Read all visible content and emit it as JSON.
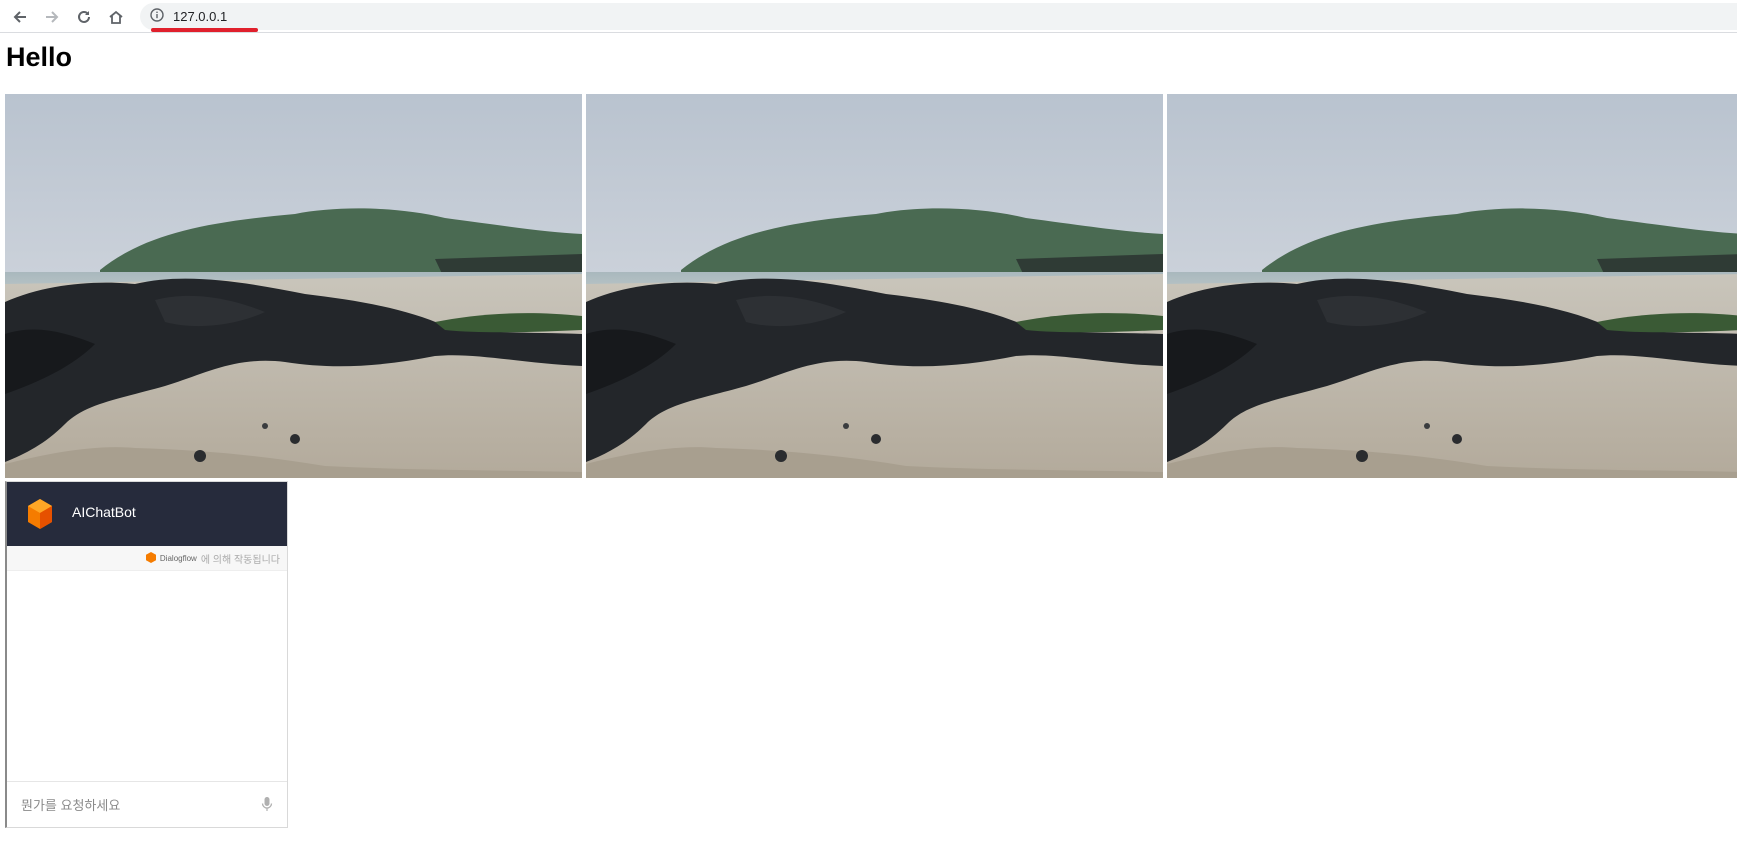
{
  "browser": {
    "url": "127.0.0.1",
    "icons": [
      "back-icon",
      "forward-icon",
      "reload-icon",
      "home-icon",
      "info-icon"
    ]
  },
  "page": {
    "heading": "Hello"
  },
  "photos": [
    {
      "name": "beach-photo-1"
    },
    {
      "name": "beach-photo-2"
    },
    {
      "name": "beach-photo-3"
    }
  ],
  "chatbot": {
    "title": "AIChatBot",
    "powered_by_brand": "Dialogflow",
    "powered_by_suffix": "에 의해 작동됩니다",
    "input_placeholder": "뭔가를 요청하세요",
    "input_value": "",
    "header_color": "#262b3c",
    "logo_color": "#f57c00"
  }
}
